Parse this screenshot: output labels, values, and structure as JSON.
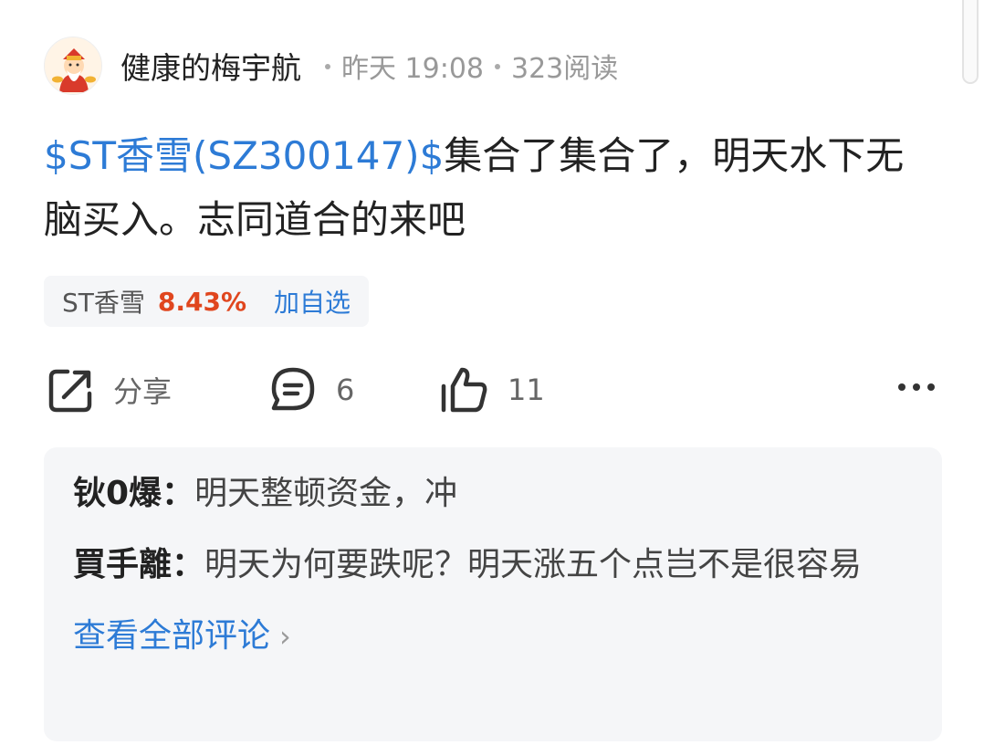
{
  "post": {
    "author": "健康的梅宇航",
    "time": "昨天 19:08",
    "reads": "323阅读",
    "stock_tag": "$ST香雪(SZ300147)$",
    "body": "集合了集合了，明天水下无脑买入。志同道合的来吧"
  },
  "stock_chip": {
    "name": "ST香雪",
    "change": "8.43%",
    "add_label": "加自选",
    "change_color": "#e0461e"
  },
  "actions": {
    "share_label": "分享",
    "comment_count": "6",
    "like_count": "11"
  },
  "comments": [
    {
      "author": "钬0爆：",
      "text": "明天整顿资金，冲"
    },
    {
      "author": "買手離：",
      "text": "明天为何要跌呢？明天涨五个点岂不是很容易"
    }
  ],
  "view_all_label": "查看全部评论",
  "colors": {
    "link": "#2d7bd6",
    "up": "#e0461e"
  },
  "icons": [
    "avatar-god-of-wealth",
    "share-icon",
    "comment-icon",
    "like-icon",
    "more-icon",
    "chevron-right-icon"
  ]
}
